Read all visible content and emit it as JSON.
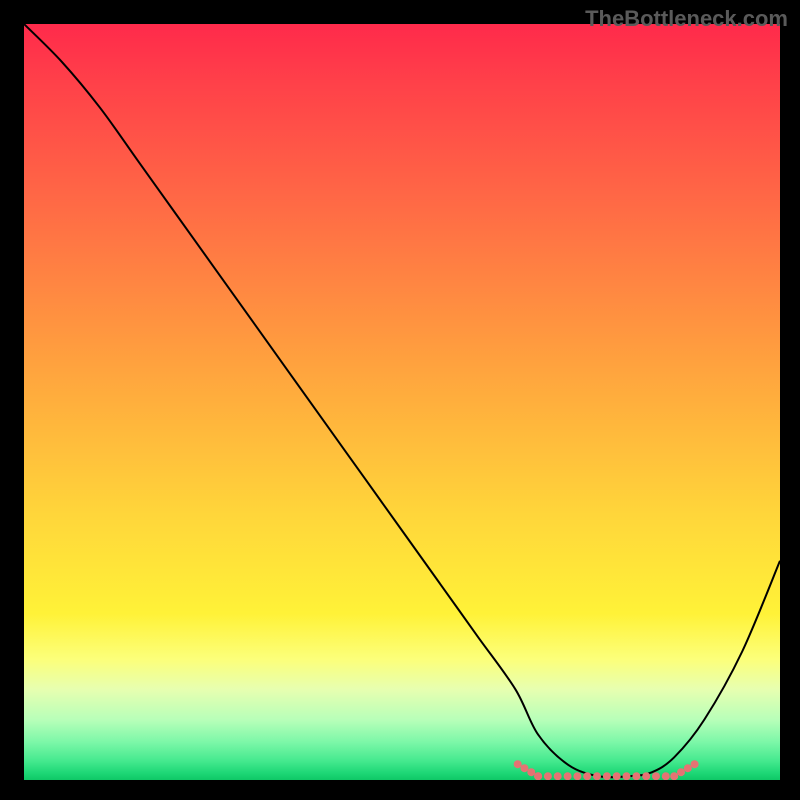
{
  "watermark": "TheBottleneck.com",
  "chart_data": {
    "type": "line",
    "title": "",
    "xlabel": "",
    "ylabel": "",
    "xlim": [
      0,
      100
    ],
    "ylim": [
      0,
      100
    ],
    "series": [
      {
        "name": "bottleneck-curve",
        "x": [
          0,
          5,
          10,
          15,
          20,
          25,
          30,
          35,
          40,
          45,
          50,
          55,
          60,
          65,
          68,
          72,
          76,
          80,
          83,
          86,
          90,
          95,
          100
        ],
        "values": [
          100,
          95,
          89,
          82,
          75,
          68,
          61,
          54,
          47,
          40,
          33,
          26,
          19,
          12,
          6,
          2,
          0.5,
          0.5,
          1,
          3,
          8,
          17,
          29
        ]
      }
    ],
    "annotations": [
      {
        "name": "plateau-markers",
        "x_range": [
          68,
          86
        ],
        "y": 0.5
      }
    ],
    "colors": {
      "curve": "#000000",
      "marker": "#e57373",
      "gradient_top": "#ff2a4b",
      "gradient_bottom": "#0fc866"
    }
  }
}
